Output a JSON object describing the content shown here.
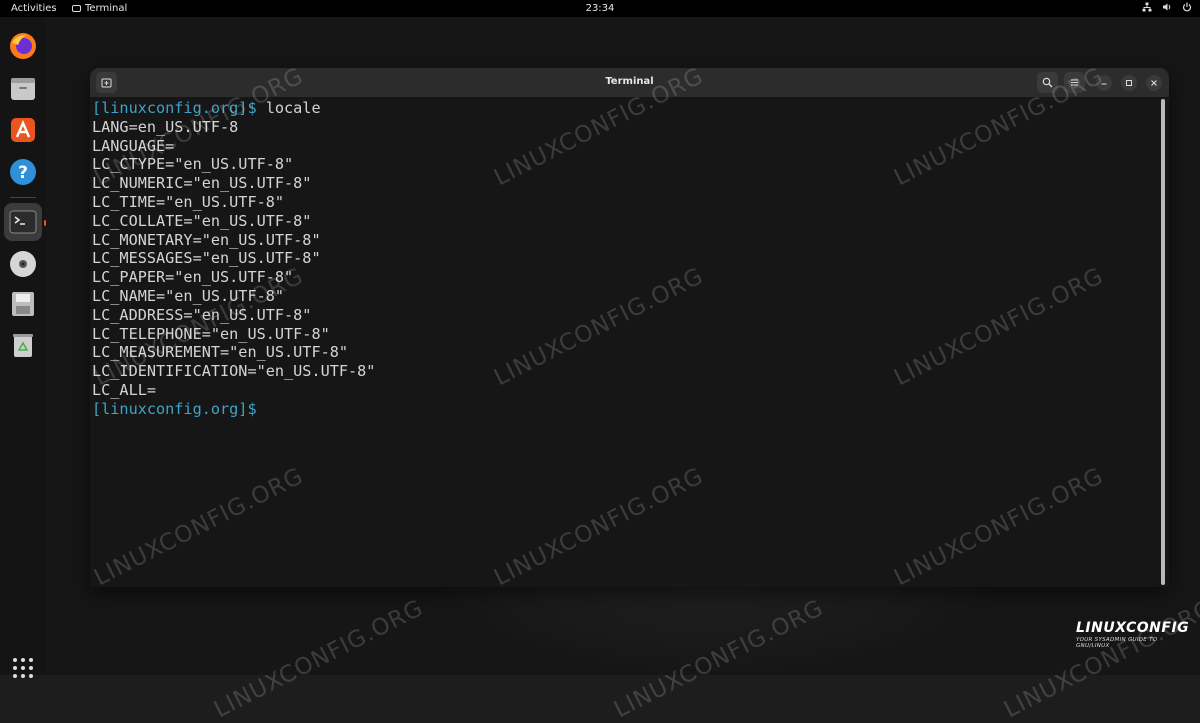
{
  "topbar": {
    "activities": "Activities",
    "app_name": "Terminal",
    "clock": "23:34",
    "tray_icons": [
      "network-icon",
      "volume-icon",
      "power-icon"
    ]
  },
  "dock": {
    "items": [
      "firefox-icon",
      "files-icon",
      "software-icon",
      "help-icon",
      "terminal-icon",
      "disc-icon",
      "save-icon",
      "trash-icon"
    ],
    "active_item": "terminal-icon",
    "app_grid_icon": "app-grid-icon"
  },
  "window": {
    "title": "Terminal",
    "header_buttons": [
      "new-tab-icon",
      "search-icon",
      "menu-icon",
      "minimize-icon",
      "maximize-icon",
      "close-icon"
    ]
  },
  "terminal": {
    "prompt": "[linuxconfig.org]$",
    "command": " locale",
    "output": [
      "LANG=en_US.UTF-8",
      "LANGUAGE=",
      "LC_CTYPE=\"en_US.UTF-8\"",
      "LC_NUMERIC=\"en_US.UTF-8\"",
      "LC_TIME=\"en_US.UTF-8\"",
      "LC_COLLATE=\"en_US.UTF-8\"",
      "LC_MONETARY=\"en_US.UTF-8\"",
      "LC_MESSAGES=\"en_US.UTF-8\"",
      "LC_PAPER=\"en_US.UTF-8\"",
      "LC_NAME=\"en_US.UTF-8\"",
      "LC_ADDRESS=\"en_US.UTF-8\"",
      "LC_TELEPHONE=\"en_US.UTF-8\"",
      "LC_MEASUREMENT=\"en_US.UTF-8\"",
      "LC_IDENTIFICATION=\"en_US.UTF-8\"",
      "LC_ALL="
    ],
    "final_prompt": "[linuxconfig.org]$"
  },
  "watermark": "LINUXCONFIG.ORG",
  "brand": {
    "name": "LINUXCONFIG",
    "tagline": "YOUR SYSADMIN GUIDE TO GNU/LINUX"
  },
  "colors": {
    "prompt": "#3fa2c8",
    "terminal_text": "#d4d4d4",
    "accent": "#e95420",
    "brand_accent": "#3fa2c8"
  }
}
